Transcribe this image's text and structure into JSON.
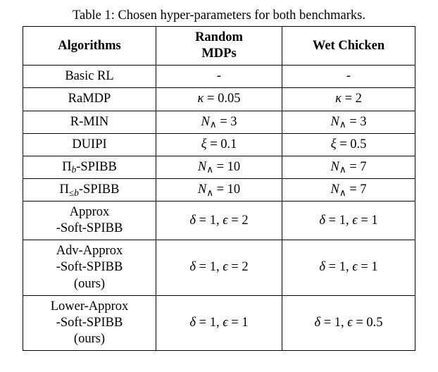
{
  "caption": "Table 1: Chosen hyper-parameters for both benchmarks.",
  "headers": {
    "col1": "Algorithms",
    "col2_l1": "Random",
    "col2_l2": "MDPs",
    "col3": "Wet Chicken"
  },
  "rows": [
    {
      "alg_html": "Basic RL",
      "mdp_html": "-",
      "wc_html": "-"
    },
    {
      "alg_html": "RaMDP",
      "mdp_html": "<span class='mi'>κ</span> = 0.05",
      "wc_html": "<span class='mi'>κ</span> = 2"
    },
    {
      "alg_html": "R-MIN",
      "mdp_html": "<span class='mi'>N</span><span class='sub'>∧</span> = 3",
      "wc_html": "<span class='mi'>N</span><span class='sub'>∧</span> = 3"
    },
    {
      "alg_html": "DUIPI",
      "mdp_html": "<span class='mi'>ξ</span> = 0.1",
      "wc_html": "<span class='mi'>ξ</span> = 0.5"
    },
    {
      "alg_html": "Π<span class='sub mi'>b</span>-SPIBB",
      "mdp_html": "<span class='mi'>N</span><span class='sub'>∧</span> = 10",
      "wc_html": "<span class='mi'>N</span><span class='sub'>∧</span> = 7"
    },
    {
      "alg_html": "Π<span class='sub'>≤<span class='mi'>b</span></span>-SPIBB",
      "mdp_html": "<span class='mi'>N</span><span class='sub'>∧</span> = 10",
      "wc_html": "<span class='mi'>N</span><span class='sub'>∧</span> = 7"
    },
    {
      "alg_html": "Approx<br>-Soft-SPIBB",
      "mdp_html": "<span class='mi'>δ</span> = 1, <span class='mi'>ϵ</span> = 2",
      "wc_html": "<span class='mi'>δ</span> = 1, <span class='mi'>ϵ</span> = 1"
    },
    {
      "alg_html": "Adv-Approx<br>-Soft-SPIBB<br>(ours)",
      "mdp_html": "<span class='mi'>δ</span> = 1, <span class='mi'>ϵ</span> = 2",
      "wc_html": "<span class='mi'>δ</span> = 1, <span class='mi'>ϵ</span> = 1"
    },
    {
      "alg_html": "Lower-Approx<br>-Soft-SPIBB<br>(ours)",
      "mdp_html": "<span class='mi'>δ</span> = 1, <span class='mi'>ϵ</span> = 1",
      "wc_html": "<span class='mi'>δ</span> = 1, <span class='mi'>ϵ</span> = 0.5"
    }
  ],
  "chart_data": {
    "type": "table",
    "title": "Chosen hyper-parameters for both benchmarks",
    "columns": [
      "Algorithms",
      "Random MDPs",
      "Wet Chicken"
    ],
    "rows": [
      [
        "Basic RL",
        "-",
        "-"
      ],
      [
        "RaMDP",
        "kappa = 0.05",
        "kappa = 2"
      ],
      [
        "R-MIN",
        "N_wedge = 3",
        "N_wedge = 3"
      ],
      [
        "DUIPI",
        "xi = 0.1",
        "xi = 0.5"
      ],
      [
        "Pi_b-SPIBB",
        "N_wedge = 10",
        "N_wedge = 7"
      ],
      [
        "Pi_<=b-SPIBB",
        "N_wedge = 10",
        "N_wedge = 7"
      ],
      [
        "Approx-Soft-SPIBB",
        "delta = 1, epsilon = 2",
        "delta = 1, epsilon = 1"
      ],
      [
        "Adv-Approx-Soft-SPIBB (ours)",
        "delta = 1, epsilon = 2",
        "delta = 1, epsilon = 1"
      ],
      [
        "Lower-Approx-Soft-SPIBB (ours)",
        "delta = 1, epsilon = 1",
        "delta = 1, epsilon = 0.5"
      ]
    ]
  }
}
